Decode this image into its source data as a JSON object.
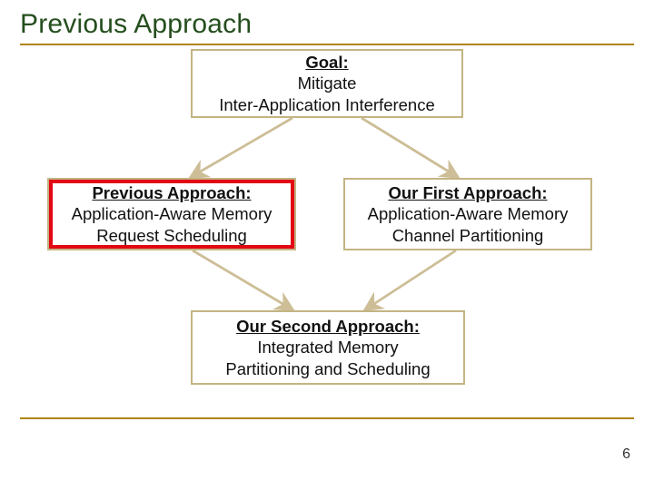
{
  "slide": {
    "title": "Previous Approach",
    "accent_color": "#B0840C",
    "title_color": "#254E1E",
    "page_number": "6"
  },
  "diagram": {
    "goal": {
      "heading": "Goal:",
      "line1": "Mitigate",
      "line2": "Inter-Application Interference"
    },
    "previous": {
      "heading": "Previous Approach:",
      "line1": "Application-Aware Memory",
      "line2": "Request Scheduling",
      "highlighted": true,
      "highlight_color": "#E30613"
    },
    "first": {
      "heading": "Our First Approach:",
      "line1": "Application-Aware Memory",
      "line2": "Channel Partitioning"
    },
    "second": {
      "heading": "Our Second Approach:",
      "line1": "Integrated Memory",
      "line2": "Partitioning and Scheduling"
    },
    "arrows": [
      {
        "from": "goal",
        "to": "previous"
      },
      {
        "from": "goal",
        "to": "first"
      },
      {
        "from": "previous",
        "to": "second"
      },
      {
        "from": "first",
        "to": "second"
      }
    ]
  }
}
